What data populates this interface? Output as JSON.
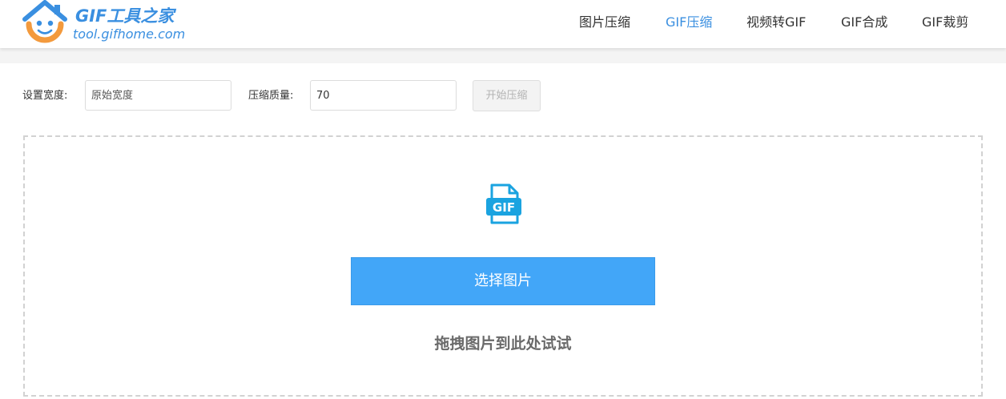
{
  "brand": {
    "title": "GIF工具之家",
    "domain": "tool.gifhome.com",
    "color_primary": "#3a8fe0",
    "color_accent": "#f39a3d"
  },
  "nav": {
    "items": [
      {
        "label": "图片压缩",
        "active": false
      },
      {
        "label": "GIF压缩",
        "active": true
      },
      {
        "label": "视频转GIF",
        "active": false
      },
      {
        "label": "GIF合成",
        "active": false
      },
      {
        "label": "GIF裁剪",
        "active": false
      }
    ],
    "active_color": "#3a8fe0"
  },
  "options": {
    "width_label": "设置宽度:",
    "width_placeholder": "原始宽度",
    "width_value": "",
    "quality_label": "压缩质量:",
    "quality_value": "70",
    "start_label": "开始压缩",
    "start_disabled": true
  },
  "upload": {
    "icon": "gif-file-icon",
    "icon_text": "GIF",
    "icon_color": "#1aa3e0",
    "select_label": "选择图片",
    "select_color": "#42a6f8",
    "hint": "拖拽图片到此处试试"
  }
}
